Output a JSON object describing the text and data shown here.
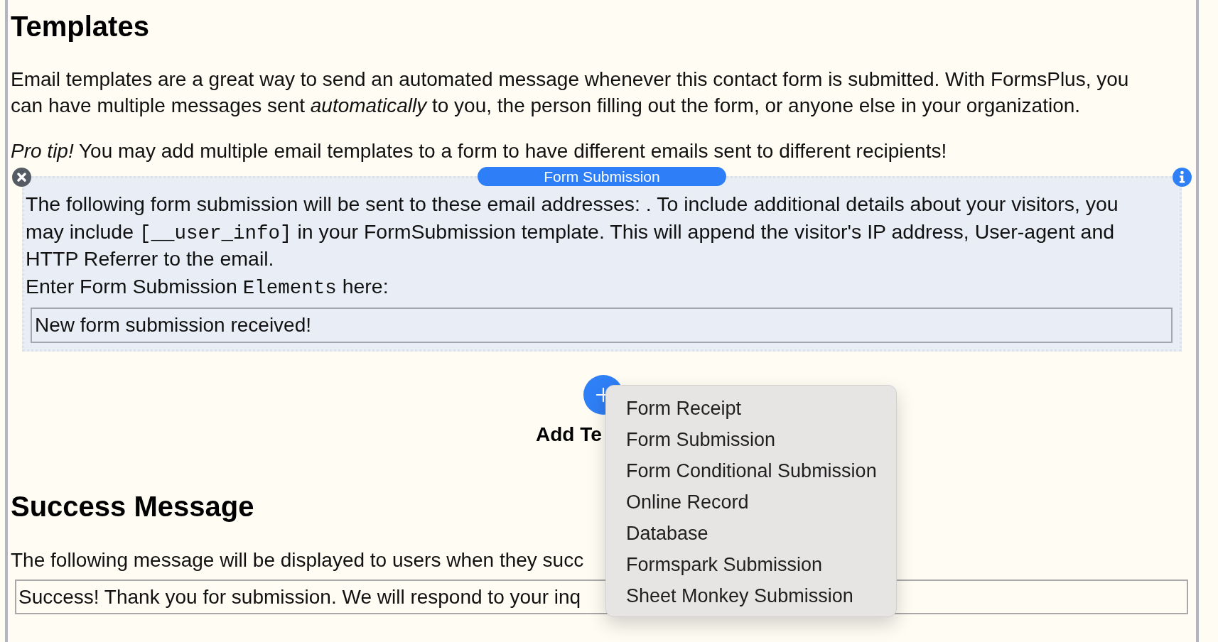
{
  "templates_section": {
    "heading": "Templates",
    "intro": "Email templates are a great way to send an automated message whenever this contact form is submitted. With FormsPlus, you can have multiple messages sent *automatically* to you, the person filling out the form, or anyone else in your organization.",
    "tip": "*Pro tip!* You may add multiple email templates to a form to have different emails sent to different recipients!",
    "template_card": {
      "title": "Form Submission",
      "description": [
        {
          "kind": "text",
          "text": "The following form submission will be sent to these email addresses: . To include additional details about your visitors, you may include "
        },
        {
          "kind": "code",
          "text": "[__user_info]"
        },
        {
          "kind": "text",
          "text": " in your FormSubmission template. This will append the visitor's IP address, User-agent and HTTP Referrer to the email."
        }
      ],
      "field_label": [
        {
          "kind": "text",
          "text": "Enter Form Submission "
        },
        {
          "kind": "code",
          "text": "Elements"
        },
        {
          "kind": "text",
          "text": " here:"
        }
      ],
      "field_value": "New form submission received!"
    },
    "add_template": {
      "label": "Add Te"
    },
    "add_menu": {
      "items": [
        "Form Receipt",
        "Form Submission",
        "Form Conditional Submission",
        "Online Record",
        "Database",
        "Formspark Submission",
        "Sheet Monkey Submission"
      ]
    }
  },
  "success_section": {
    "heading": "Success Message",
    "description": "The following message will be displayed to users when they succ",
    "field_value": "Success! Thank you for submission. We will respond to your inq"
  }
}
